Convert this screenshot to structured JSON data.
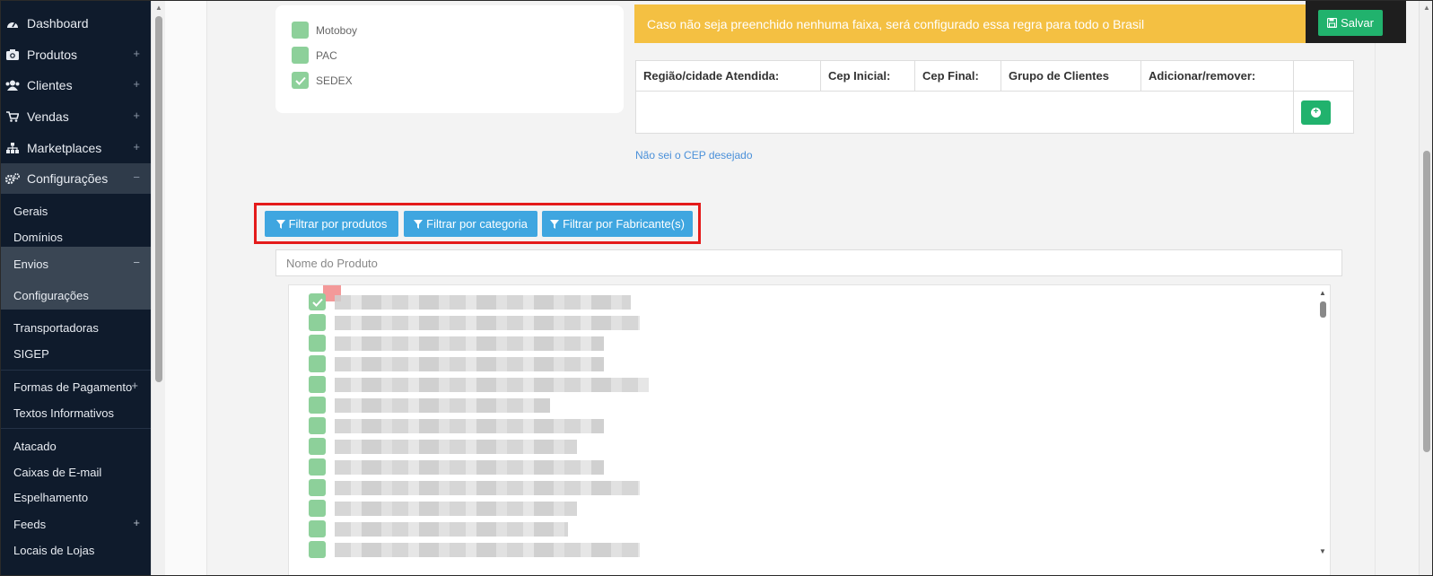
{
  "sidebar": {
    "items": [
      {
        "label": "Dashboard",
        "icon": "dashboard-icon",
        "expand": ""
      },
      {
        "label": "Produtos",
        "icon": "camera-icon",
        "expand": "+"
      },
      {
        "label": "Clientes",
        "icon": "users-icon",
        "expand": "+"
      },
      {
        "label": "Vendas",
        "icon": "cart-icon",
        "expand": "+"
      },
      {
        "label": "Marketplaces",
        "icon": "sitemap-icon",
        "expand": "+"
      },
      {
        "label": "Configurações",
        "icon": "gears-icon",
        "expand": "−"
      }
    ],
    "config_sub": {
      "gerais": "Gerais",
      "dominios": "Domínios",
      "envios": "Envios",
      "envios_toggle": "−",
      "envios_config": "Configurações",
      "transportadoras": "Transportadoras",
      "sigep": "SIGEP",
      "formas_pagamento": "Formas de Pagamento",
      "formas_pagamento_toggle": "+",
      "textos_informativos": "Textos Informativos",
      "atacado": "Atacado",
      "caixas_email": "Caixas de E-mail",
      "espelhamento": "Espelhamento",
      "feeds": "Feeds",
      "feeds_toggle": "+",
      "locais_lojas": "Locais de Lojas"
    }
  },
  "shipping_methods": [
    {
      "label": "Motoboy",
      "checked": false
    },
    {
      "label": "PAC",
      "checked": false
    },
    {
      "label": "SEDEX",
      "checked": true
    }
  ],
  "alert": {
    "text": "Caso não seja preenchido nenhuma faixa, será configurado essa regra para todo o Brasil"
  },
  "save_button": {
    "label": "Salvar"
  },
  "cep_table": {
    "headers": [
      "Região/cidade Atendida:",
      "Cep Inicial:",
      "Cep Final:",
      "Grupo de Clientes",
      "Adicionar/remover:",
      ""
    ]
  },
  "cep_link": "Não sei o CEP desejado",
  "filters": {
    "produtos": "Filtrar por produtos",
    "categoria": "Filtrar por categoria",
    "fabricante": "Filtrar por Fabricante(s)"
  },
  "search": {
    "placeholder": "Nome do Produto"
  },
  "product_list": {
    "row_count": 13,
    "first_checked": true
  },
  "colors": {
    "sidebar_bg": "#0f1b2c",
    "alert": "#f4c042",
    "success": "#21b26d",
    "filter_button": "#3fa6e0",
    "checkbox": "#8dd09a",
    "highlight_box": "#e41b1b"
  }
}
